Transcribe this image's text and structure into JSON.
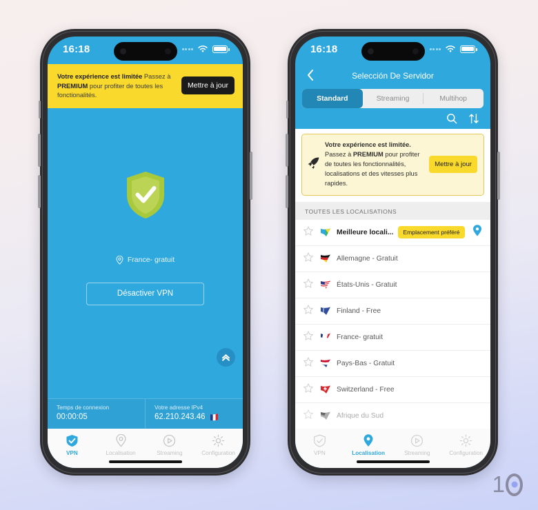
{
  "watermark": {
    "text": "10"
  },
  "phone1": {
    "status": {
      "time": "16:18"
    },
    "banner": {
      "bold1": "Votre expérience est limitée",
      "mid": " Passez à ",
      "bold2": "PREMIUM",
      "tail": " pour profiter de toutes les fonctionalités.",
      "cta": "Mettre à jour"
    },
    "location_label": "France- gratuit",
    "disconnect_label": "Désactiver VPN",
    "info": {
      "time_label": "Temps de connexion",
      "time_value": "00:00:05",
      "ip_label": "Votre adresse IPv4",
      "ip_value": "62.210.243.46"
    },
    "tabs": [
      {
        "label": "VPN",
        "icon": "shield-check-icon",
        "active": true
      },
      {
        "label": "Localisation",
        "icon": "map-pin-icon",
        "active": false
      },
      {
        "label": "Streaming",
        "icon": "play-circle-icon",
        "active": false
      },
      {
        "label": "Configuration",
        "icon": "gear-icon",
        "active": false
      }
    ]
  },
  "phone2": {
    "status": {
      "time": "16:18"
    },
    "title": "Selección De Servidor",
    "segments": [
      {
        "label": "Standard",
        "active": true
      },
      {
        "label": "Streaming",
        "active": false
      },
      {
        "label": "Multihop",
        "active": false
      }
    ],
    "banner": {
      "bold1": "Votre expérience est limitée.",
      "mid": "Passez à ",
      "bold2": "PREMIUM",
      "tail": " pour profiter de toutes les fonctionnalités, localisations et des vitesses plus rapides.",
      "cta": "Mettre à jour"
    },
    "section_header": "TOUTES LES LOCALISATIONS",
    "rows": [
      {
        "name": "Meilleure locali...",
        "badge": "Emplacement préféré",
        "best": true,
        "flag": "best-flag-icon",
        "faded": false
      },
      {
        "name": "Allemagne - Gratuit",
        "badge": "",
        "best": false,
        "flag": "germany-flag-icon",
        "faded": false
      },
      {
        "name": "États-Unis - Gratuit",
        "badge": "",
        "best": false,
        "flag": "usa-flag-icon",
        "faded": false
      },
      {
        "name": "Finland - Free",
        "badge": "",
        "best": false,
        "flag": "finland-flag-icon",
        "faded": false
      },
      {
        "name": "France- gratuit",
        "badge": "",
        "best": false,
        "flag": "france-flag-icon",
        "faded": false
      },
      {
        "name": "Pays-Bas - Gratuit",
        "badge": "",
        "best": false,
        "flag": "netherlands-flag-icon",
        "faded": false
      },
      {
        "name": "Switzerland - Free",
        "badge": "",
        "best": false,
        "flag": "switzerland-flag-icon",
        "faded": false
      },
      {
        "name": "Afrique du Sud",
        "badge": "",
        "best": false,
        "flag": "southafrica-flag-icon",
        "faded": true
      }
    ],
    "tabs": [
      {
        "label": "VPN",
        "icon": "shield-check-icon",
        "active": false
      },
      {
        "label": "Localisation",
        "icon": "map-pin-icon",
        "active": true
      },
      {
        "label": "Streaming",
        "icon": "play-circle-icon",
        "active": false
      },
      {
        "label": "Configuration",
        "icon": "gear-icon",
        "active": false
      }
    ]
  },
  "colors": {
    "brand_blue": "#2fa8dd",
    "accent_yellow": "#f9d92b",
    "shield_green": "#a9c93c",
    "dark_button": "#1b1b1b"
  }
}
